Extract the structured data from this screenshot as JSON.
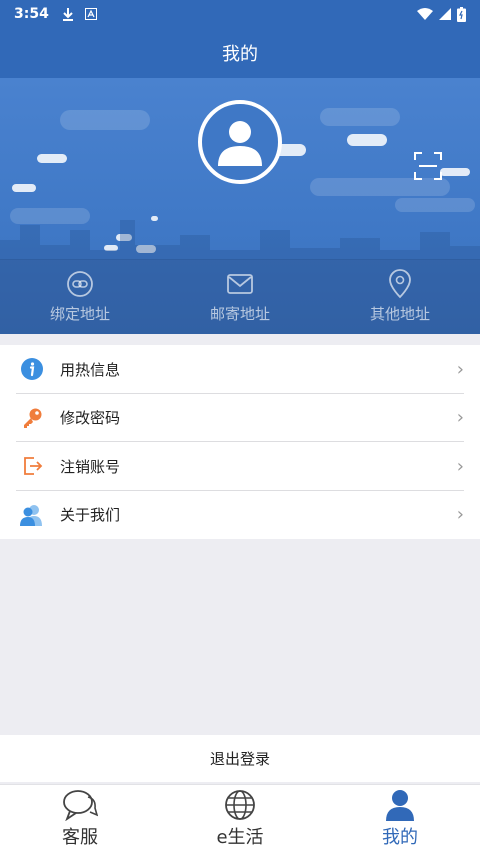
{
  "status_bar": {
    "time": "3:54"
  },
  "header": {
    "title": "我的"
  },
  "address_bar": {
    "items": [
      {
        "label": "绑定地址",
        "icon": "link-icon"
      },
      {
        "label": "邮寄地址",
        "icon": "mail-icon"
      },
      {
        "label": "其他地址",
        "icon": "location-pin-icon"
      }
    ]
  },
  "menu": {
    "items": [
      {
        "label": "用热信息",
        "icon": "info-icon",
        "color": "#3b8fe0"
      },
      {
        "label": "修改密码",
        "icon": "key-icon",
        "color": "#f07d3c"
      },
      {
        "label": "注销账号",
        "icon": "logout-icon",
        "color": "#f07d3c"
      },
      {
        "label": "关于我们",
        "icon": "users-icon",
        "color": "#3b8fe0"
      }
    ]
  },
  "logout": {
    "label": "退出登录"
  },
  "tabbar": {
    "tabs": [
      {
        "label": "客服",
        "icon": "chat-bubble-icon",
        "active": false
      },
      {
        "label": "e生活",
        "icon": "globe-icon",
        "active": false
      },
      {
        "label": "我的",
        "icon": "user-icon",
        "active": true
      }
    ]
  },
  "colors": {
    "primary": "#3169b8",
    "accent_orange": "#f07d3c",
    "accent_blue": "#3b8fe0"
  }
}
